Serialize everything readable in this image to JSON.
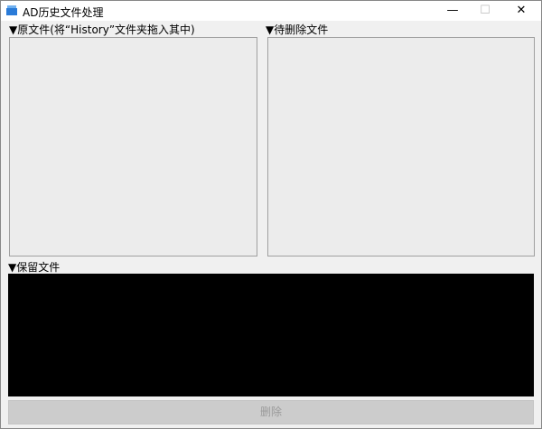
{
  "window": {
    "title": "AD历史文件处理",
    "minimize": "—",
    "maximize": "☐",
    "close": "✕"
  },
  "panels": {
    "source_label": "▼原文件(将“History”文件夹拖入其中)",
    "pending_label": "▼待删除文件",
    "keep_label": "▼保留文件"
  },
  "actions": {
    "delete_label": "删除"
  }
}
